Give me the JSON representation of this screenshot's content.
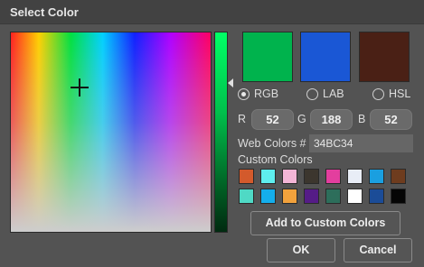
{
  "window": {
    "title": "Select Color"
  },
  "preview": {
    "colors": [
      "#00B34D",
      "#1A57D5",
      "#4A2015"
    ],
    "names": [
      "current-color",
      "selected-color",
      "previous-color"
    ]
  },
  "modes": [
    {
      "label": "RGB",
      "selected": true
    },
    {
      "label": "LAB",
      "selected": false
    },
    {
      "label": "HSL",
      "selected": false
    }
  ],
  "channels": [
    {
      "label": "R",
      "value": "52"
    },
    {
      "label": "G",
      "value": "188"
    },
    {
      "label": "B",
      "value": "52"
    }
  ],
  "web_colors": {
    "label": "Web Colors #",
    "value": "34BC34"
  },
  "custom_colors": {
    "label": "Custom Colors",
    "row1": [
      "#D35A2C",
      "#5EEEEE",
      "#F3B5D6",
      "#3C362E",
      "#E33E9E",
      "#E8EDF6",
      "#1A9FE0",
      "#6E3C1E"
    ],
    "row2": [
      "#4FD9C5",
      "#14AEEB",
      "#F2A23C",
      "#551C87",
      "#2D6E5B",
      "#FFFFFF",
      "#1B4C97",
      "#050505"
    ]
  },
  "buttons": {
    "add_custom": "Add to Custom Colors",
    "ok": "OK",
    "cancel": "Cancel"
  }
}
